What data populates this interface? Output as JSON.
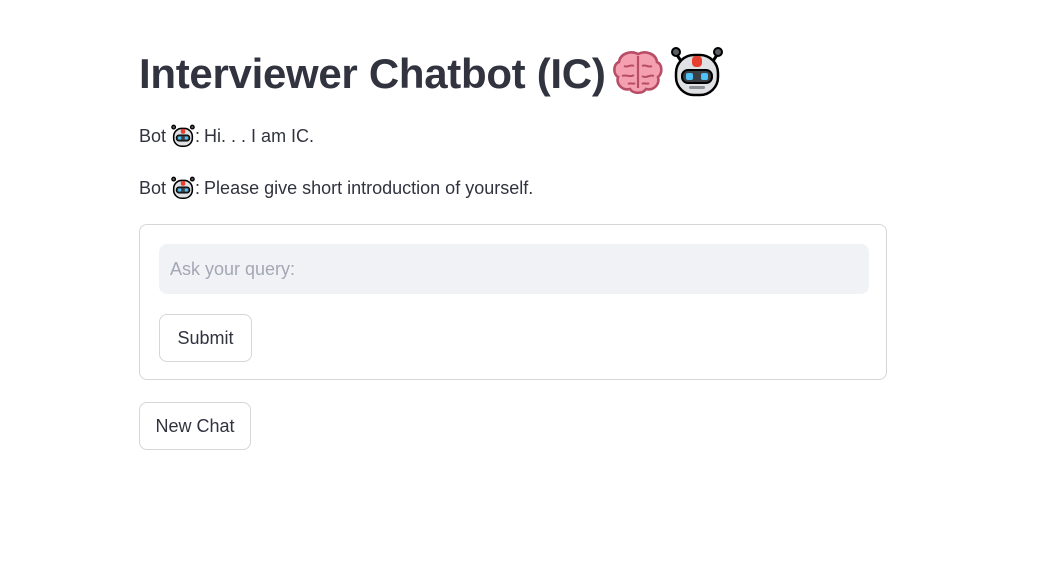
{
  "header": {
    "title": "Interviewer Chatbot (IC)",
    "title_icons": [
      "brain-icon",
      "robot-icon"
    ]
  },
  "messages": [
    {
      "speaker": "Bot",
      "icon": "robot-icon",
      "separator": ":",
      "text": "Hi. . . I am IC."
    },
    {
      "speaker": "Bot",
      "icon": "robot-icon",
      "separator": ":",
      "text": "Please give short introduction of yourself."
    }
  ],
  "form": {
    "query_placeholder": "Ask your query:",
    "query_value": "",
    "submit_label": "Submit"
  },
  "actions": {
    "new_chat_label": "New Chat"
  },
  "colors": {
    "text": "#31333f",
    "border": "#d6d6d9",
    "input_bg": "#f0f2f6",
    "placeholder": "#a3a8b4"
  }
}
